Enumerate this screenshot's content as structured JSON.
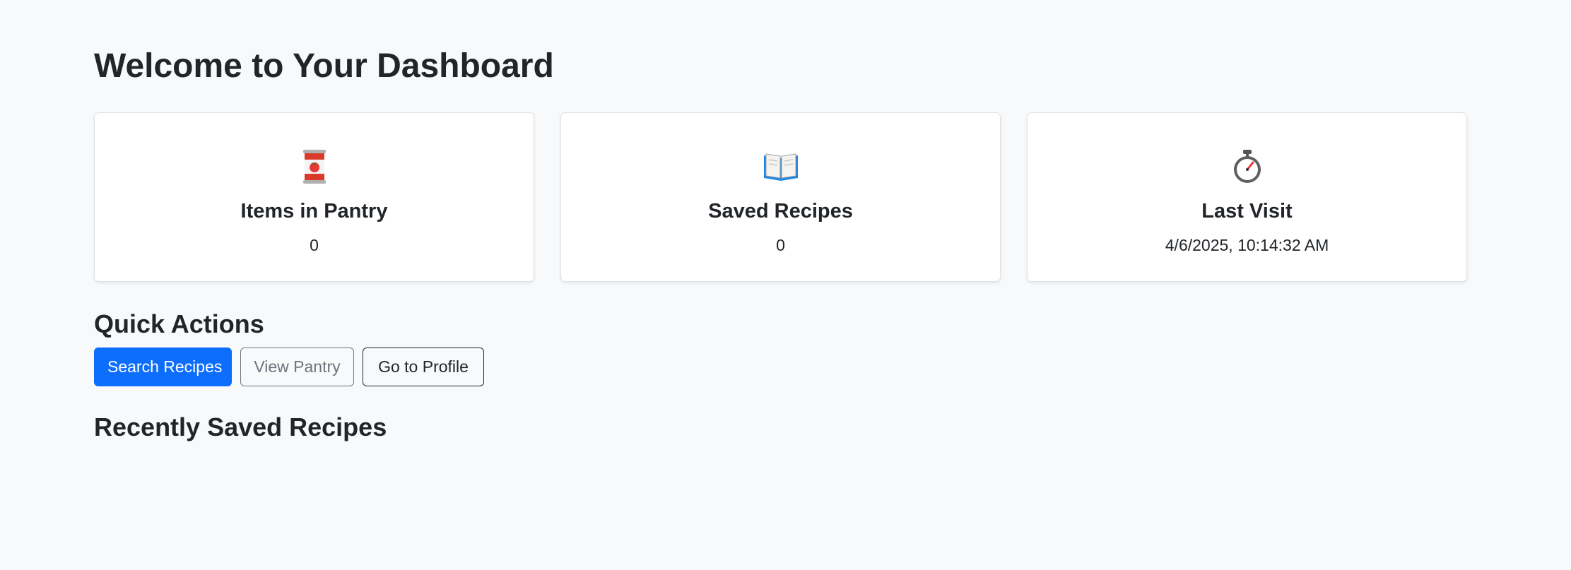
{
  "page": {
    "title": "Welcome to Your Dashboard"
  },
  "stats": [
    {
      "icon": "tomato-can-icon",
      "label": "Items in Pantry",
      "value": "0"
    },
    {
      "icon": "open-book-icon",
      "label": "Saved Recipes",
      "value": "0"
    },
    {
      "icon": "stopwatch-icon",
      "label": "Last Visit",
      "value": "4/6/2025, 10:14:32 AM"
    }
  ],
  "quick_actions": {
    "title": "Quick Actions",
    "search_label": "Search Recipes",
    "pantry_label": "View Pantry",
    "profile_label": "Go to Profile"
  },
  "recent": {
    "title": "Recently Saved Recipes"
  },
  "colors": {
    "background": "#f8f9fa",
    "primary": "#0d6efd",
    "secondary": "#6c757d",
    "dark": "#212529",
    "card_border": "#dee2e6"
  }
}
